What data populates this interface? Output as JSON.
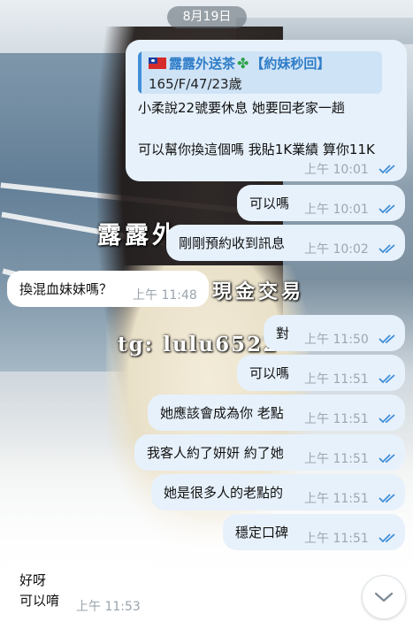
{
  "date": "8月19日",
  "watermarks": {
    "line1": "露露外",
    "line2": "現金交易",
    "line3": "tg: lulu6522"
  },
  "messages": [
    {
      "id": "m1",
      "dir": "out",
      "reply": {
        "title": "露露外送茶",
        "title_tag": "【約妹秒回】",
        "subtitle": "165/F/47/23歲"
      },
      "lines": [
        "小柔說22號要休息 她要回老家一趟",
        "可以幫你換這個嗎  我貼1K業績 算你11K"
      ],
      "time": "上午 10:01",
      "read": true
    },
    {
      "id": "m2",
      "dir": "out",
      "lines": [
        "可以嗎"
      ],
      "time": "上午 10:01",
      "read": true
    },
    {
      "id": "m3",
      "dir": "out",
      "lines": [
        "剛剛預約收到訊息"
      ],
      "time": "上午 10:02",
      "read": true
    },
    {
      "id": "m4",
      "dir": "in",
      "lines": [
        "換混血妹妹嗎？"
      ],
      "time": "上午 11:48"
    },
    {
      "id": "m5",
      "dir": "out",
      "lines": [
        "對"
      ],
      "time": "上午 11:50",
      "read": true
    },
    {
      "id": "m6",
      "dir": "out",
      "lines": [
        "可以嗎"
      ],
      "time": "上午 11:51",
      "read": true
    },
    {
      "id": "m7",
      "dir": "out",
      "lines": [
        "她應該會成為你 老點"
      ],
      "time": "上午 11:51",
      "read": true
    },
    {
      "id": "m8",
      "dir": "out",
      "lines": [
        "我客人約了妍妍 約了她"
      ],
      "time": "上午 11:51",
      "read": true
    },
    {
      "id": "m9",
      "dir": "out",
      "lines": [
        "她是很多人的老點的"
      ],
      "time": "上午 11:51",
      "read": true
    },
    {
      "id": "m10",
      "dir": "out",
      "lines": [
        "穩定口碑"
      ],
      "time": "上午 11:51",
      "read": true
    },
    {
      "id": "m11",
      "dir": "in",
      "lines": [
        "好呀",
        "可以唷"
      ],
      "time": "上午 11:53"
    }
  ],
  "icons": {
    "read_check": "double-check-icon",
    "scroll_down": "chevron-down-icon"
  },
  "colors": {
    "outgoing_bubble": "#e7f1fb",
    "incoming_bubble": "#ffffff",
    "accent": "#3f8ed8",
    "time": "#9aa7b4"
  }
}
